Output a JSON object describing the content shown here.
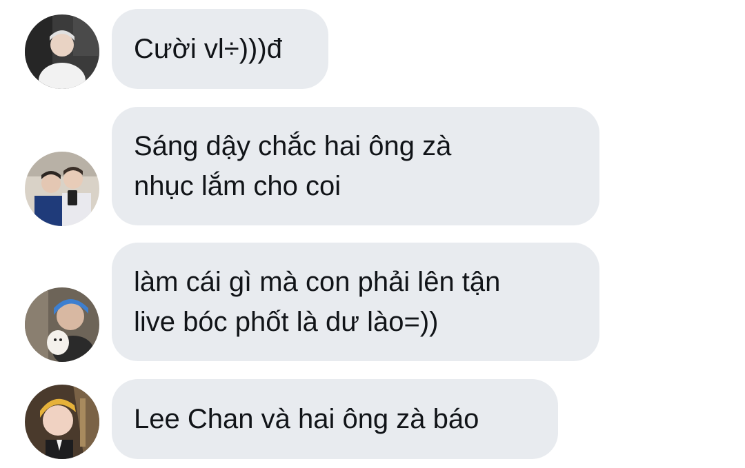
{
  "messages": [
    {
      "text": "Cười vl÷)))đ",
      "avatar_icon": "avatar-photo-white-hoodie-icon"
    },
    {
      "text": "Sáng dậy chắc hai ông zà\nnhục lắm cho coi",
      "avatar_icon": "avatar-photo-mirror-selfie-icon"
    },
    {
      "text": "làm cái gì mà con phải lên tận\nlive bóc phốt là dư lào=))",
      "avatar_icon": "avatar-photo-blue-hair-dog-icon"
    },
    {
      "text": "Lee Chan và hai ông zà báo",
      "avatar_icon": "avatar-photo-blonde-hair-icon"
    }
  ],
  "colors": {
    "bubble_bg": "#e8ebef",
    "text": "#111418",
    "page_bg": "#ffffff"
  }
}
